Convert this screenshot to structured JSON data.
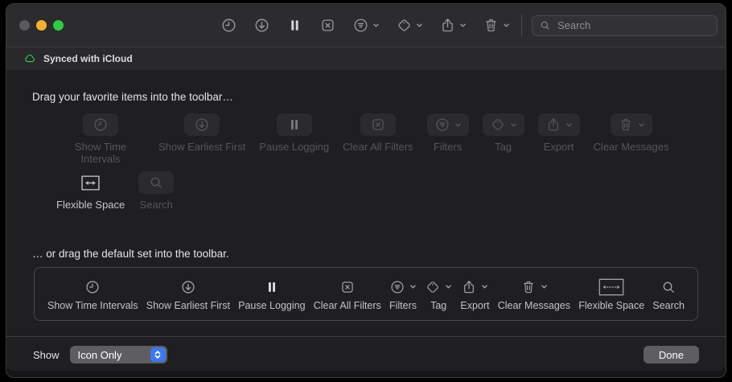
{
  "window": {
    "traffic_lights": [
      {
        "name": "close",
        "color": "#5a5a5e"
      },
      {
        "name": "minimize",
        "color": "#f6b12e"
      },
      {
        "name": "zoom",
        "color": "#2ecb43"
      }
    ],
    "toolbar": {
      "items": [
        {
          "name": "show-time-intervals",
          "icon": "clock",
          "chevron": false
        },
        {
          "name": "show-earliest-first",
          "icon": "arrow-down-circle",
          "chevron": false
        },
        {
          "name": "pause-logging",
          "icon": "pause",
          "chevron": false
        },
        {
          "name": "clear-all-filters",
          "icon": "clear-filters",
          "chevron": false
        },
        {
          "name": "filters",
          "icon": "filter",
          "chevron": true
        },
        {
          "name": "tag",
          "icon": "tag",
          "chevron": true
        },
        {
          "name": "export",
          "icon": "share",
          "chevron": true
        },
        {
          "name": "clear-messages",
          "icon": "trash",
          "chevron": true
        }
      ],
      "search_placeholder": "Search"
    },
    "status_bar": {
      "icon": "cloud",
      "text": "Synced with iCloud",
      "icon_color": "#30d158"
    }
  },
  "sheet": {
    "drag_items_heading": "Drag your favorite items into the toolbar…",
    "default_set_heading": "… or drag the default set into the toolbar.",
    "palette": [
      {
        "name": "show-time-intervals",
        "label": "Show Time Intervals",
        "icon": "clock",
        "chevron": false,
        "dimmed": true
      },
      {
        "name": "show-earliest-first",
        "label": "Show Earliest First",
        "icon": "arrow-down-circle",
        "chevron": false,
        "dimmed": true
      },
      {
        "name": "pause-logging",
        "label": "Pause Logging",
        "icon": "pause",
        "chevron": false,
        "dimmed": true
      },
      {
        "name": "clear-all-filters",
        "label": "Clear All Filters",
        "icon": "clear-filters",
        "chevron": false,
        "dimmed": true
      },
      {
        "name": "filters",
        "label": "Filters",
        "icon": "filter",
        "chevron": true,
        "dimmed": true
      },
      {
        "name": "tag",
        "label": "Tag",
        "icon": "tag",
        "chevron": true,
        "dimmed": true
      },
      {
        "name": "export",
        "label": "Export",
        "icon": "share",
        "chevron": true,
        "dimmed": true
      },
      {
        "name": "clear-messages",
        "label": "Clear Messages",
        "icon": "trash",
        "chevron": true,
        "dimmed": true
      },
      {
        "name": "flexible-space",
        "label": "Flexible Space",
        "icon": "flex-space",
        "chevron": false,
        "dimmed": false
      },
      {
        "name": "search",
        "label": "Search",
        "icon": "magnifier",
        "chevron": false,
        "dimmed": true
      }
    ],
    "default_set": [
      {
        "name": "show-time-intervals",
        "label": "Show Time Intervals",
        "icon": "clock",
        "chevron": false
      },
      {
        "name": "show-earliest-first",
        "label": "Show Earliest First",
        "icon": "arrow-down-circle",
        "chevron": false
      },
      {
        "name": "pause-logging",
        "label": "Pause Logging",
        "icon": "pause",
        "chevron": false
      },
      {
        "name": "clear-all-filters",
        "label": "Clear All Filters",
        "icon": "clear-filters",
        "chevron": false
      },
      {
        "name": "filters",
        "label": "Filters",
        "icon": "filter",
        "chevron": true
      },
      {
        "name": "tag",
        "label": "Tag",
        "icon": "tag",
        "chevron": true
      },
      {
        "name": "export",
        "label": "Export",
        "icon": "share",
        "chevron": true
      },
      {
        "name": "clear-messages",
        "label": "Clear Messages",
        "icon": "trash",
        "chevron": true
      },
      {
        "name": "flexible-space",
        "label": "Flexible Space",
        "icon": "flex-space-wide",
        "chevron": false
      },
      {
        "name": "search",
        "label": "Search",
        "icon": "magnifier",
        "chevron": false
      }
    ],
    "footer": {
      "show_label": "Show",
      "show_value": "Icon Only",
      "done_label": "Done",
      "accent_color": "#3d78f2"
    }
  }
}
